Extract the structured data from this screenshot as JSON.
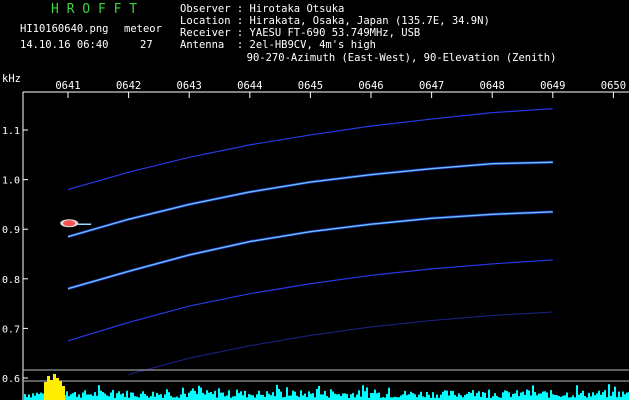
{
  "header": {
    "logo": "H R O F F T",
    "filename": "HI10160640.png",
    "datetime": "14.10.16 06:40",
    "meteor_label": "meteor",
    "meteor_count": "27",
    "info": [
      {
        "key": "Observer ",
        "value": ": Hirotaka Otsuka"
      },
      {
        "key": "Location ",
        "value": ": Hirakata, Osaka, Japan (135.7E, 34.9N)"
      },
      {
        "key": "Receiver ",
        "value": ": YAESU FT-690 53.749MHz, USB"
      },
      {
        "key": "Antenna  ",
        "value": ": 2el-HB9CV, 4m's high"
      }
    ],
    "antenna_line2": "  90-270-Azimuth (East-West), 90-Elevation (Zenith)"
  },
  "colors": {
    "logo": "#3cd43c",
    "axis": "#ffffff",
    "trace": "#2b3fff",
    "trace_bright": "#6fc8ff",
    "level": "#00ffff",
    "burst": "#ffee00",
    "meteor": "#ff3030"
  },
  "chart_data": {
    "type": "spectrogram",
    "y_unit_label": "kHz",
    "x_ticks": [
      "0641",
      "0642",
      "0643",
      "0644",
      "0645",
      "0646",
      "0647",
      "0648",
      "0649",
      "0650"
    ],
    "y_ticks": [
      "1.1",
      "1.0",
      "0.9",
      "0.8",
      "0.7",
      "0.6"
    ],
    "ylim": [
      0.58,
      1.2
    ],
    "xlim": [
      0,
      9.25
    ],
    "traces": [
      {
        "points": [
          [
            0,
            0.98
          ],
          [
            1,
            1.015
          ],
          [
            2,
            1.045
          ],
          [
            3,
            1.07
          ],
          [
            4,
            1.09
          ],
          [
            5,
            1.108
          ],
          [
            6,
            1.122
          ],
          [
            7,
            1.135
          ],
          [
            8,
            1.143
          ]
        ],
        "brightness": "dim"
      },
      {
        "points": [
          [
            0,
            0.885
          ],
          [
            1,
            0.92
          ],
          [
            2,
            0.95
          ],
          [
            3,
            0.975
          ],
          [
            4,
            0.995
          ],
          [
            5,
            1.01
          ],
          [
            6,
            1.022
          ],
          [
            7,
            1.032
          ],
          [
            8,
            1.035
          ]
        ],
        "brightness": "bright"
      },
      {
        "points": [
          [
            0,
            0.78
          ],
          [
            1,
            0.815
          ],
          [
            2,
            0.848
          ],
          [
            3,
            0.875
          ],
          [
            4,
            0.895
          ],
          [
            5,
            0.91
          ],
          [
            6,
            0.922
          ],
          [
            7,
            0.93
          ],
          [
            8,
            0.935
          ]
        ],
        "brightness": "bright"
      },
      {
        "points": [
          [
            0,
            0.675
          ],
          [
            1,
            0.712
          ],
          [
            2,
            0.745
          ],
          [
            3,
            0.77
          ],
          [
            4,
            0.79
          ],
          [
            5,
            0.807
          ],
          [
            6,
            0.82
          ],
          [
            7,
            0.83
          ],
          [
            8,
            0.838
          ]
        ],
        "brightness": "dim"
      },
      {
        "points": [
          [
            1,
            0.607
          ],
          [
            2,
            0.64
          ],
          [
            3,
            0.665
          ],
          [
            4,
            0.686
          ],
          [
            5,
            0.703
          ],
          [
            6,
            0.716
          ],
          [
            7,
            0.726
          ],
          [
            8,
            0.733
          ]
        ],
        "brightness": "faint"
      }
    ],
    "meteor_echoes": [
      {
        "x": 0.35,
        "y": 0.912
      }
    ],
    "level_bursts": [
      {
        "x": 0.3,
        "level": 0.9
      }
    ]
  }
}
